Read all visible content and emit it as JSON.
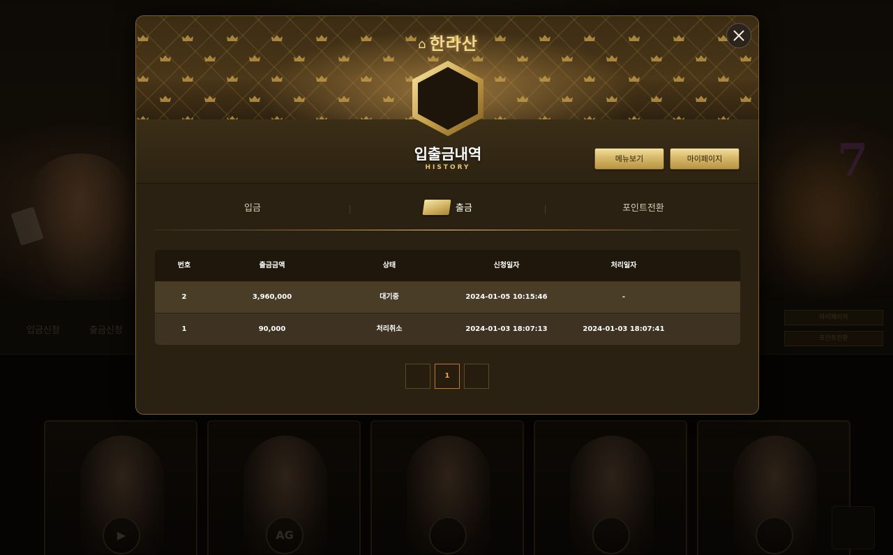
{
  "background": {
    "nav_items": [
      "입금신청",
      "출금신청"
    ],
    "side_buttons": [
      "마이페이지",
      "포인트전환"
    ],
    "game_logos": [
      "▶",
      "AG",
      "",
      "",
      ""
    ]
  },
  "modal": {
    "brand": "한라산",
    "title": "입출금내역",
    "subtitle": "HISTORY",
    "buttons": {
      "menu": "메뉴보기",
      "mypage": "마이페이지"
    },
    "tabs": [
      {
        "label": "입금",
        "active": false
      },
      {
        "label": "출금",
        "active": true
      },
      {
        "label": "포인트전환",
        "active": false
      }
    ],
    "table": {
      "headers": [
        "번호",
        "출금금액",
        "상태",
        "신청일자",
        "처리일자"
      ],
      "rows": [
        [
          "2",
          "3,960,000",
          "대기중",
          "2024-01-05 10:15:46",
          "-"
        ],
        [
          "1",
          "90,000",
          "처리취소",
          "2024-01-03 18:07:13",
          "2024-01-03 18:07:41"
        ]
      ]
    },
    "pagination": {
      "prev": "",
      "current": "1",
      "next": ""
    }
  },
  "colors": {
    "gold": "#d5b566",
    "accent_orange": "#f4a93c",
    "panel": "#2a2112"
  },
  "icons": {
    "close": "close-icon",
    "brand": "brand-logo-icon",
    "tab_active": "gold-bar-icon"
  }
}
